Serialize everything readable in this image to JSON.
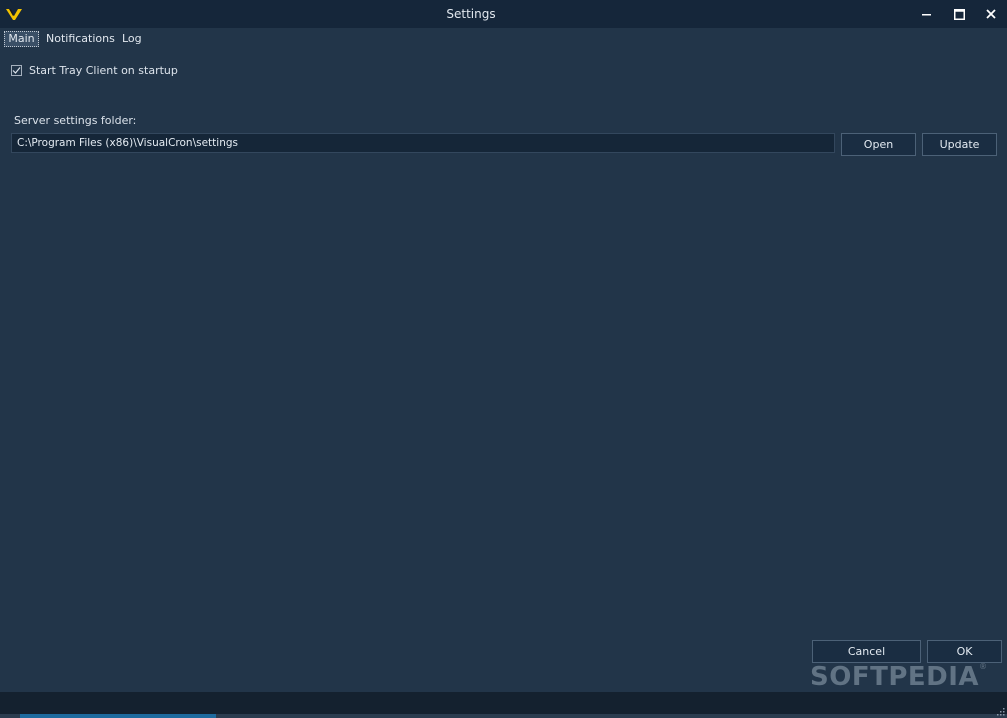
{
  "window": {
    "title": "Settings",
    "minimize_icon": "minimize-icon",
    "maximize_icon": "maximize-icon",
    "close_icon": "close-icon"
  },
  "tabs": [
    {
      "label": "Main",
      "active": true
    },
    {
      "label": "Notifications",
      "active": false
    },
    {
      "label": "Log",
      "active": false
    }
  ],
  "main": {
    "start_tray_label": "Start Tray Client on startup",
    "start_tray_checked": true,
    "server_folder_label": "Server settings folder:",
    "server_folder_value": "C:\\Program Files (x86)\\VisualCron\\settings",
    "open_label": "Open",
    "update_label": "Update"
  },
  "footer": {
    "cancel_label": "Cancel",
    "ok_label": "OK"
  },
  "watermark": {
    "text": "SOFTPEDIA",
    "mark": "®"
  },
  "colors": {
    "background": "#223549",
    "titlebar": "#15263a",
    "input_bg": "#152638",
    "logo_yellow": "#f2c200"
  }
}
